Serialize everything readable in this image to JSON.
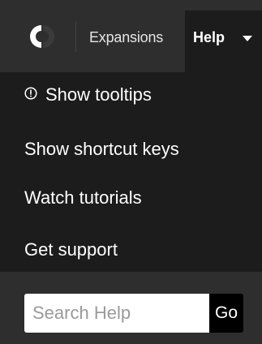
{
  "nav": {
    "logo_icon": "app-logo-icon",
    "expansions_label": "Expansions",
    "help_label": "Help",
    "help_caret_icon": "caret-down-icon"
  },
  "help_menu": {
    "items": [
      {
        "label": "Show tooltips",
        "icon": "info-circle-icon"
      },
      {
        "label": "Show shortcut keys"
      },
      {
        "label": "Watch tutorials"
      },
      {
        "label": "Get support"
      }
    ]
  },
  "search": {
    "placeholder": "Search Help",
    "value": "",
    "go_label": "Go"
  },
  "colors": {
    "bar_background": "#2e2e2e",
    "menu_background": "#1c1c1c",
    "text": "#ffffff"
  }
}
